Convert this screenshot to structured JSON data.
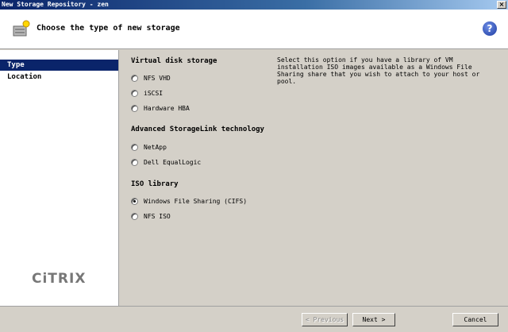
{
  "window": {
    "title": "New Storage Repository - zen"
  },
  "header": {
    "title": "Choose the type of new storage",
    "help_glyph": "?"
  },
  "sidebar": {
    "items": [
      {
        "label": "Type",
        "active": true
      },
      {
        "label": "Location",
        "active": false
      }
    ],
    "logo": "CiTRIX"
  },
  "main": {
    "sections": [
      {
        "title": "Virtual disk storage",
        "options": [
          "NFS VHD",
          "iSCSI",
          "Hardware HBA"
        ]
      },
      {
        "title": "Advanced StorageLink technology",
        "options": [
          "NetApp",
          "Dell EqualLogic"
        ]
      },
      {
        "title": "ISO library",
        "options": [
          "Windows File Sharing (CIFS)",
          "NFS ISO"
        ]
      }
    ],
    "selected": "Windows File Sharing (CIFS)",
    "description": "Select this option if you have a library of VM installation ISO images available as a Windows File Sharing share that you wish to attach to your host or pool."
  },
  "footer": {
    "previous_label": "< Previous",
    "next_label": "Next >",
    "cancel_label": "Cancel"
  },
  "colors": {
    "selection": "#0a246a",
    "background": "#d4d0c8"
  }
}
